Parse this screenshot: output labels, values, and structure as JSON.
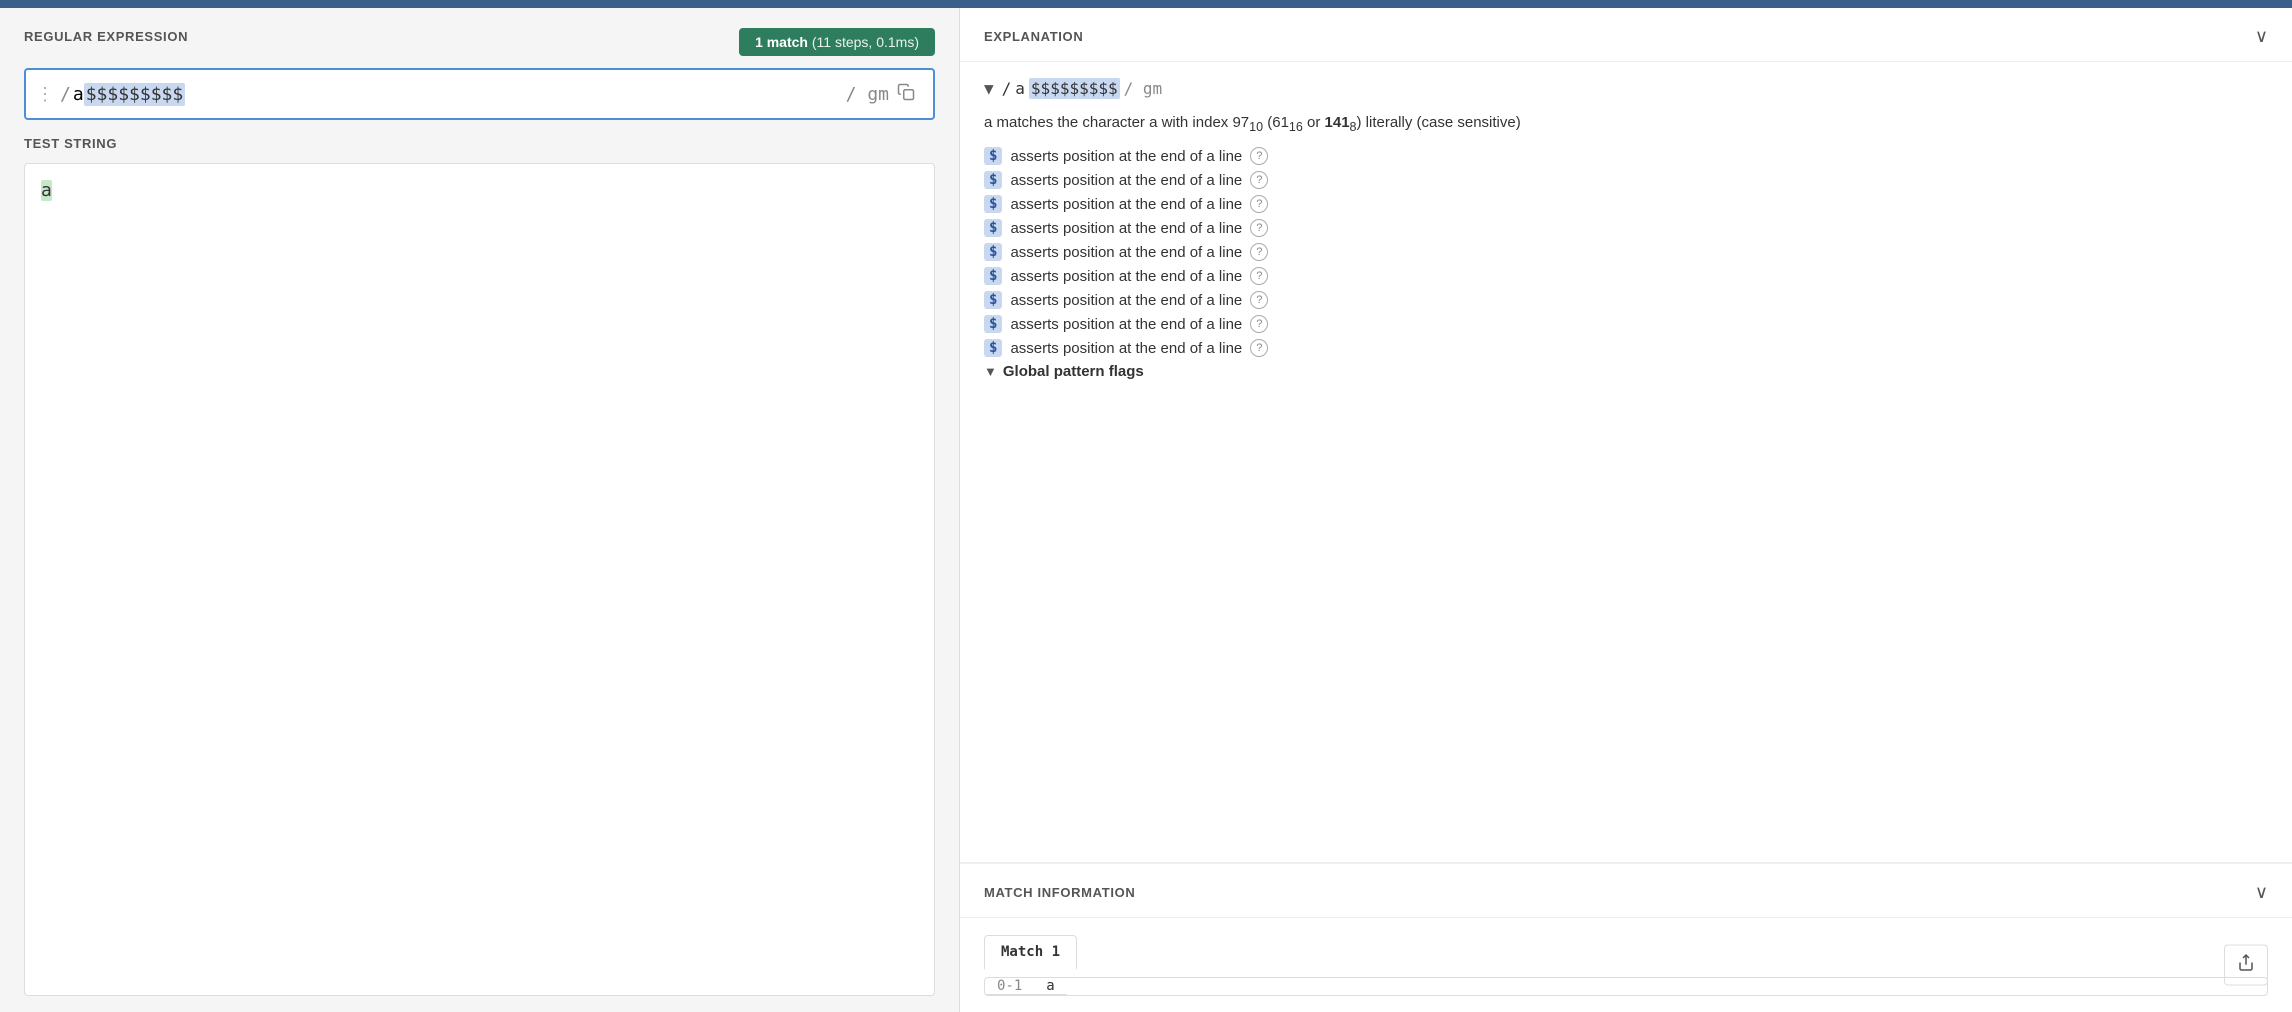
{
  "topBar": {},
  "leftPanel": {
    "regexSection": {
      "label": "REGULAR EXPRESSION",
      "matchBadge": "1 match",
      "matchDetails": "(11 steps, 0.1ms)",
      "regexPrefix": "/ ",
      "regexA": "a",
      "regexDollars": "$$$$$$$$$",
      "regexSuffix": " / gm",
      "flags": "/ gm"
    },
    "testStringSection": {
      "label": "TEST STRING",
      "content": "a"
    }
  },
  "rightPanel": {
    "explanation": {
      "label": "EXPLANATION",
      "regexDisplayPrefix": "/ ",
      "regexDisplayA": "a",
      "regexDisplayDollars": "$$$$$$$$$",
      "regexDisplaySuffix": " / gm",
      "charExplanation": "a matches the character a with index 97",
      "sub10": "10",
      "charExplanationMid": " (61",
      "sub16": "16",
      "charExplanationEnd": " or 141",
      "sub8": "8",
      "charExplanationFinal": ") literally (case sensitive)",
      "assertions": [
        "$ asserts position at the end of a line",
        "$ asserts position at the end of a line",
        "$ asserts position at the end of a line",
        "$ asserts position at the end of a line",
        "$ asserts position at the end of a line",
        "$ asserts position at the end of a line",
        "$ asserts position at the end of a line",
        "$ asserts position at the end of a line",
        "$ asserts position at the end of a line"
      ],
      "globalFlagsLabel": "Global pattern flags"
    },
    "matchInfo": {
      "label": "MATCH INFORMATION",
      "matchTab": "Match 1",
      "matchRange": "0-1",
      "matchValue": "a"
    }
  }
}
